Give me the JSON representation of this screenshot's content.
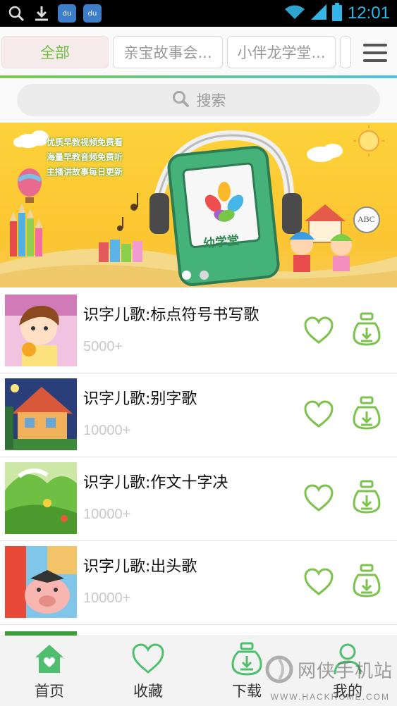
{
  "status_bar": {
    "time": "12:01"
  },
  "tabs": [
    {
      "label": "全部",
      "active": true
    },
    {
      "label": "亲宝故事会..."
    },
    {
      "label": "小伴龙学堂..."
    }
  ],
  "search": {
    "placeholder": "搜索"
  },
  "banner": {
    "bullets": [
      "优质早教视频免费看",
      "海量早教音频免费听",
      "主播讲故事每日更新"
    ],
    "logo_text": "幼学堂",
    "abc_text": "ABC",
    "pager": {
      "count": 2,
      "current": 1
    }
  },
  "items": [
    {
      "title": "识字儿歌:标点符号书写歌",
      "count": "5000+"
    },
    {
      "title": "识字儿歌:别字歌",
      "count": "10000+"
    },
    {
      "title": "识字儿歌:作文十字决",
      "count": "10000+"
    },
    {
      "title": "识字儿歌:出头歌",
      "count": "10000+"
    }
  ],
  "bottom_nav": [
    {
      "label": "首页",
      "icon": "home-icon",
      "active": true
    },
    {
      "label": "收藏",
      "icon": "heart-icon"
    },
    {
      "label": "下载",
      "icon": "download-icon"
    },
    {
      "label": "我的",
      "icon": "user-icon"
    }
  ],
  "watermark": {
    "text": "网侠手机站",
    "url": "WWW.HACKHOME.COM"
  },
  "colors": {
    "accent": "#6fbf45",
    "status_blue": "#33b5e5",
    "banner_yellow": "#fbc631"
  }
}
